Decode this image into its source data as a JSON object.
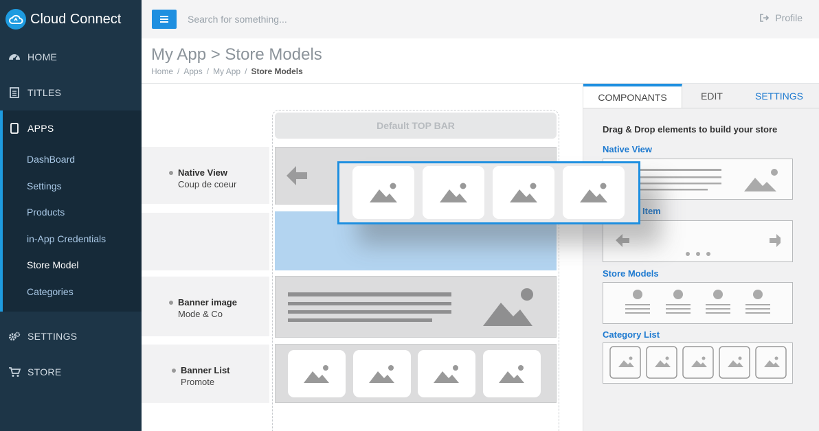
{
  "app": {
    "name": "Cloud Connect"
  },
  "sidebar": {
    "items": [
      {
        "label": "HOME",
        "icon": "dashboard-icon"
      },
      {
        "label": "TITLES",
        "icon": "document-icon"
      },
      {
        "label": "APPS",
        "icon": "tablet-icon"
      },
      {
        "label": "SETTINGS",
        "icon": "gears-icon"
      },
      {
        "label": "STORE",
        "icon": "cart-icon"
      }
    ],
    "apps_sub": [
      {
        "label": "DashBoard"
      },
      {
        "label": "Settings"
      },
      {
        "label": "Products"
      },
      {
        "label": "in-App Credentials"
      },
      {
        "label": "Store Model"
      },
      {
        "label": "Categories"
      }
    ]
  },
  "topbar": {
    "search_placeholder": "Search for something...",
    "profile_label": "Profile"
  },
  "header": {
    "title": "My App > Store Models",
    "breadcrumb": [
      "Home",
      "Apps",
      "My App",
      "Store Models"
    ],
    "separator": "/"
  },
  "canvas": {
    "top_bar_label": "Default TOP BAR",
    "rows": [
      {
        "title": "Native View",
        "subtitle": "Coup de coeur"
      },
      {
        "title": "Banner image",
        "subtitle": "Mode & Co"
      },
      {
        "title": "Banner List",
        "subtitle": "Promote"
      }
    ]
  },
  "panel": {
    "tabs": [
      "COMPONANTS",
      "EDIT",
      "SETTINGS"
    ],
    "heading": "Drag & Drop elements to build your store",
    "components": [
      {
        "label": "Native View"
      },
      {
        "label": "Item"
      },
      {
        "label": "Store Models"
      },
      {
        "label": "Category List"
      }
    ]
  },
  "colors": {
    "sidebar_bg": "#1d3547",
    "accent": "#1e8fe0",
    "link": "#1e7ad0",
    "drop_zone": "#b3d4f0"
  }
}
